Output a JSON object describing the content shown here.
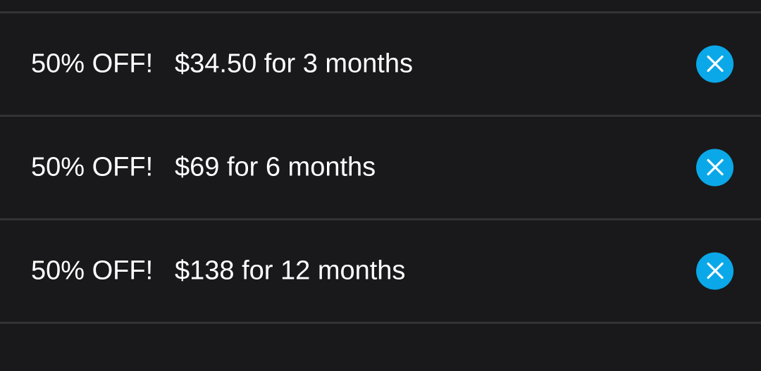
{
  "offers": [
    {
      "badge": "50% OFF!",
      "price": "$34.50 for 3 months",
      "icon": "close-icon"
    },
    {
      "badge": "50% OFF!",
      "price": "$69 for 6 months",
      "icon": "close-icon"
    },
    {
      "badge": "50% OFF!",
      "price": "$138 for 12 months",
      "icon": "close-icon"
    }
  ],
  "colors": {
    "background": "#19191b",
    "divider": "#333336",
    "accent": "#0aa8e8",
    "text": "#ffffff"
  }
}
